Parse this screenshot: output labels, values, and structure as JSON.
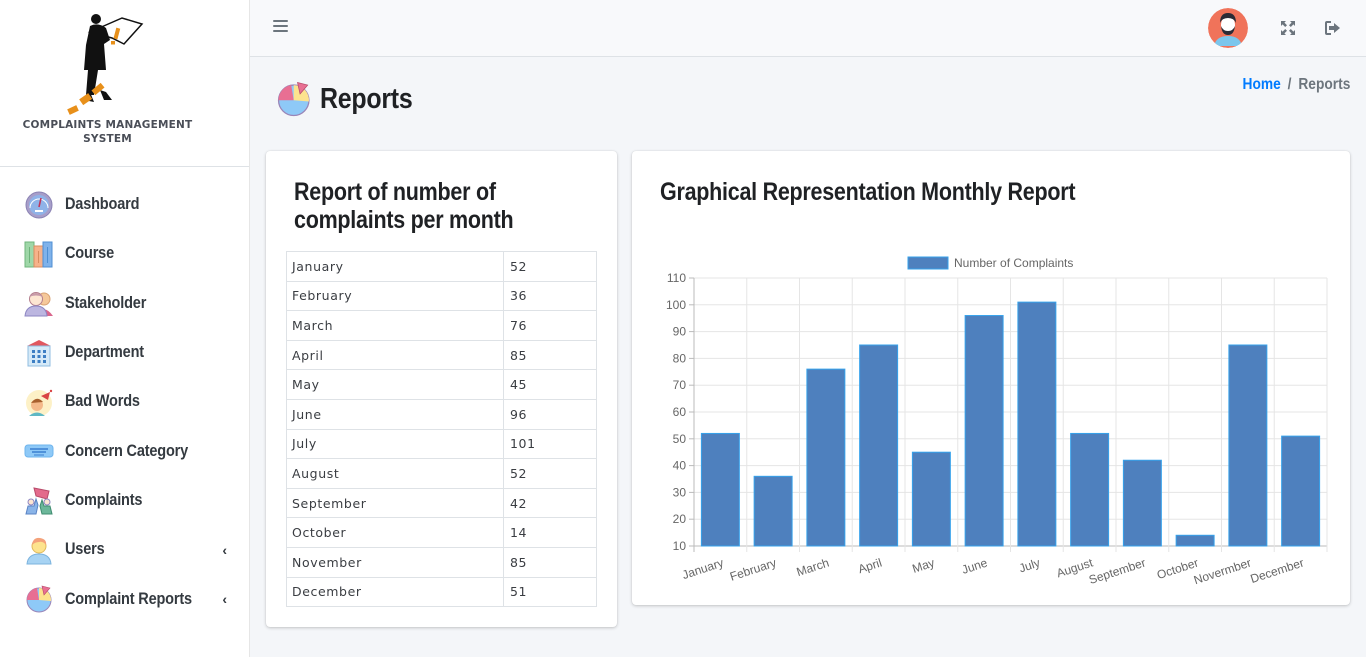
{
  "brand": {
    "line1": "COMPLAINTS MANAGEMENT",
    "line2": "SYSTEM"
  },
  "sidebar": {
    "items": [
      {
        "label": "Dashboard",
        "icon": "dashboard-gauge-icon"
      },
      {
        "label": "Course",
        "icon": "books-icon"
      },
      {
        "label": "Stakeholder",
        "icon": "people-icon"
      },
      {
        "label": "Department",
        "icon": "building-icon"
      },
      {
        "label": "Bad Words",
        "icon": "bad-words-icon"
      },
      {
        "label": "Concern Category",
        "icon": "category-icon"
      },
      {
        "label": "Complaints",
        "icon": "complaints-icon"
      },
      {
        "label": "Users",
        "icon": "user-icon",
        "has_submenu": true
      },
      {
        "label": "Complaint Reports",
        "icon": "pie-chart-icon",
        "has_submenu": true
      }
    ],
    "chevron": "‹"
  },
  "topbar": {
    "menu_icon": "hamburger-icon",
    "avatar": "user-avatar",
    "fullscreen_icon": "expand-icon",
    "logout_icon": "logout-icon"
  },
  "page": {
    "title": "Reports",
    "breadcrumb": {
      "home": "Home",
      "separator": "/",
      "current": "Reports"
    }
  },
  "table_card": {
    "title": "Report of number of complaints per month",
    "rows": [
      {
        "month": "January",
        "count": "52"
      },
      {
        "month": "February",
        "count": "36"
      },
      {
        "month": "March",
        "count": "76"
      },
      {
        "month": "April",
        "count": "85"
      },
      {
        "month": "May",
        "count": "45"
      },
      {
        "month": "June",
        "count": "96"
      },
      {
        "month": "July",
        "count": "101"
      },
      {
        "month": "August",
        "count": "52"
      },
      {
        "month": "September",
        "count": "42"
      },
      {
        "month": "October",
        "count": "14"
      },
      {
        "month": "November",
        "count": "85"
      },
      {
        "month": "December",
        "count": "51"
      }
    ]
  },
  "chart_card": {
    "title": "Graphical Representation Monthly Report"
  },
  "colors": {
    "bar_fill": "#4e80be",
    "bar_border": "#36a2eb",
    "link": "#007bff"
  },
  "chart_data": {
    "type": "bar",
    "title": "",
    "categories": [
      "January",
      "February",
      "March",
      "April",
      "May",
      "June",
      "July",
      "August",
      "September",
      "October",
      "Novermber",
      "December"
    ],
    "series": [
      {
        "name": "Number of Complaints",
        "values": [
          52,
          36,
          76,
          85,
          45,
          96,
          101,
          52,
          42,
          14,
          85,
          51
        ]
      }
    ],
    "yticks": [
      10,
      20,
      30,
      40,
      50,
      60,
      70,
      80,
      90,
      100,
      110
    ],
    "ylim": [
      10,
      110
    ],
    "xlabel": "",
    "ylabel": "",
    "grid": true,
    "legend": "top-center"
  }
}
